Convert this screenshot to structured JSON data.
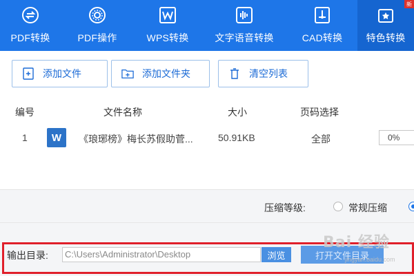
{
  "nav": {
    "items": [
      {
        "label": "PDF转换",
        "icon": "pdf-convert-icon"
      },
      {
        "label": "PDF操作",
        "icon": "gear-icon"
      },
      {
        "label": "WPS转换",
        "icon": "word-icon"
      },
      {
        "label": "文字语音转换",
        "icon": "audio-wave-icon"
      },
      {
        "label": "CAD转换",
        "icon": "cad-icon"
      },
      {
        "label": "特色转换",
        "icon": "star-image-icon"
      }
    ],
    "badge": "新",
    "active_index": 5,
    "colors": {
      "bar": "#1e76e8",
      "active": "#1565d0"
    }
  },
  "toolbar": {
    "add_file": "添加文件",
    "add_folder": "添加文件夹",
    "clear_list": "清空列表"
  },
  "table": {
    "headers": [
      "编号",
      "文件名称",
      "大小",
      "页码选择"
    ],
    "rows": [
      {
        "index": "1",
        "icon_letter": "W",
        "name": "《琅琊榜》梅长苏假助菅...",
        "size": "50.91KB",
        "pages": "全部",
        "progress": "0%"
      }
    ]
  },
  "compression": {
    "label": "压缩等级:",
    "option": "常规压缩"
  },
  "output": {
    "label": "输出目录:",
    "path": "C:\\Users\\Administrator\\Desktop",
    "browse": "浏览",
    "open": "打开文件目录"
  },
  "watermark": {
    "text": "Bai 经验",
    "sub": "jingyan.baidu.com"
  }
}
